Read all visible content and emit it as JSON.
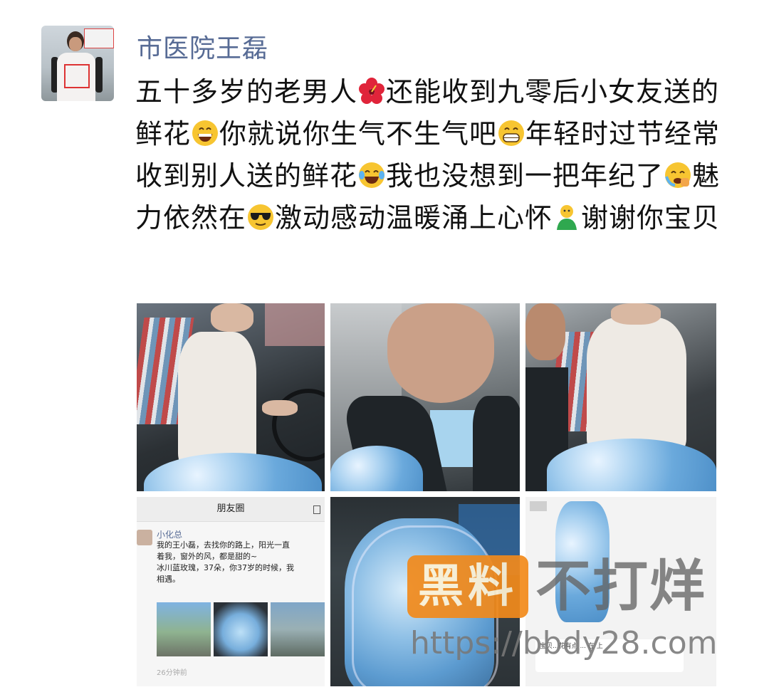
{
  "author": {
    "name": "市医院王磊"
  },
  "post": {
    "segments": [
      "五十多岁的老男人",
      "还能收到九零后小女友送的鲜花",
      "你就说你生气不生气吧",
      "年轻时过节经常收到别人送的鲜花",
      "我也没想到一把年纪了",
      "魅力依然在",
      "激动感动温暖涌上心怀",
      "谢谢你宝贝"
    ],
    "emojis": [
      "hibiscus-icon",
      "grinning-face-icon",
      "grin-teeth-icon",
      "laugh-tears-icon",
      "sad-tears-icon",
      "sunglasses-face-icon",
      "green-figure-icon"
    ]
  },
  "screenshot_moments": {
    "header": "朋友圈",
    "poster": "小化总",
    "text": "我的王小磊，去找你的路上，阳光一直\n着我，窗外的风，都是甜的~\n冰川蓝玫瑰，37朵，你37岁的时候，我\n相遇。",
    "time": "26分钟前"
  },
  "screenshot_chat": {
    "text": "宝贝...花有点 ... 在\n上"
  },
  "watermark": {
    "badge": "黑料",
    "text": "不打烊",
    "url": "https://bbdy28.com"
  }
}
